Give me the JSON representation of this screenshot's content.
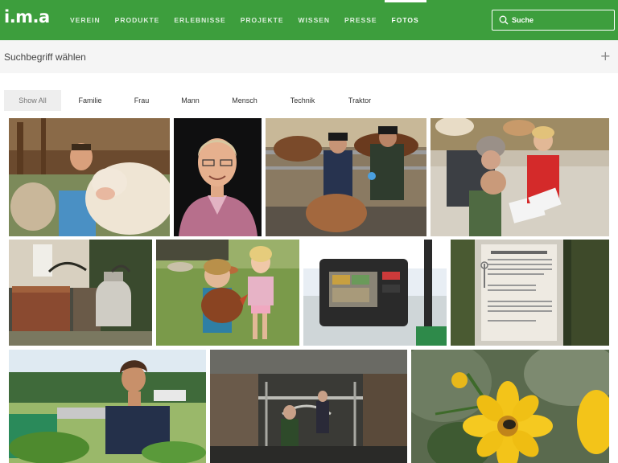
{
  "header": {
    "logo_text": "i.m.a",
    "nav": [
      {
        "label": "VEREIN"
      },
      {
        "label": "PRODUKTE"
      },
      {
        "label": "ERLEBNISSE"
      },
      {
        "label": "PROJEKTE"
      },
      {
        "label": "WISSEN"
      },
      {
        "label": "PRESSE"
      },
      {
        "label": "FOTOS",
        "active": true
      }
    ],
    "search_placeholder": "Suche",
    "search_icon": "search-icon"
  },
  "termbar": {
    "label": "Suchbegriff wählen",
    "expand_icon": "plus-icon",
    "expand_glyph": "+"
  },
  "filters": [
    {
      "label": "Show All",
      "active": true
    },
    {
      "label": "Familie"
    },
    {
      "label": "Frau"
    },
    {
      "label": "Mann"
    },
    {
      "label": "Mensch"
    },
    {
      "label": "Technik"
    },
    {
      "label": "Traktor"
    }
  ],
  "colors": {
    "brand_green": "#3d9e3d",
    "termbar_bg": "#f5f5f5",
    "active_filter_bg": "#eeeeee"
  },
  "photos": [
    {
      "subject": "man-with-cow"
    },
    {
      "subject": "man-portrait"
    },
    {
      "subject": "farmers-with-calf"
    },
    {
      "subject": "children-writing-in-cowshed"
    },
    {
      "subject": "old-milk-cans"
    },
    {
      "subject": "children-with-chicken"
    },
    {
      "subject": "tractor-display-terminal"
    },
    {
      "subject": "information-sign"
    },
    {
      "subject": "young-man-in-field"
    },
    {
      "subject": "milking-parlour"
    },
    {
      "subject": "yellow-flower-with-bee"
    }
  ]
}
